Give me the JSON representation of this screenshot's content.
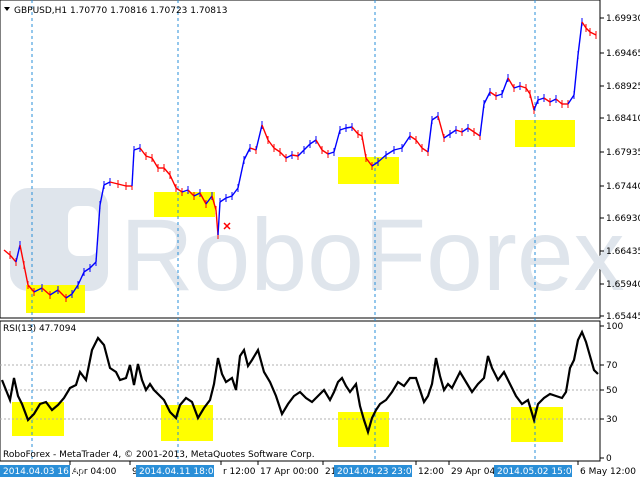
{
  "price_panel": {
    "symbol_header": "GBPUSD,H1  1.70770 1.70816 1.70723 1.70813",
    "y_ticks": [
      "1.69930",
      "1.69465",
      "1.68925",
      "1.68410",
      "1.67935",
      "1.67440",
      "1.66930",
      "1.66435",
      "1.65940",
      "1.65445"
    ],
    "watermark": "RoboForex",
    "colors": {
      "bull": "#0000ff",
      "bear": "#ff0000",
      "highlight": "#ffff00",
      "watermark": "#dfe5ec",
      "separator": "#2a8fd8"
    }
  },
  "rsi_panel": {
    "header": "RSI(13) 47.7094",
    "y_ticks": [
      "100",
      "70",
      "50",
      "30",
      "0"
    ]
  },
  "copyright": "RoboForex - MetaTrader 4, © 2001-2013, MetaQuotes Software Corp.",
  "time_axis": {
    "labels": [
      "Apr 04:00",
      "9",
      "r 12:00",
      "17 Apr 00:00",
      "21",
      "12:00",
      "29 Apr 04:",
      "6 May 12:00"
    ],
    "highlighted_labels": [
      "2014.04.03 16:00",
      "2014.04.11 18:00",
      "2014.04.23 23:00",
      "2014.05.02 15:00"
    ]
  }
}
